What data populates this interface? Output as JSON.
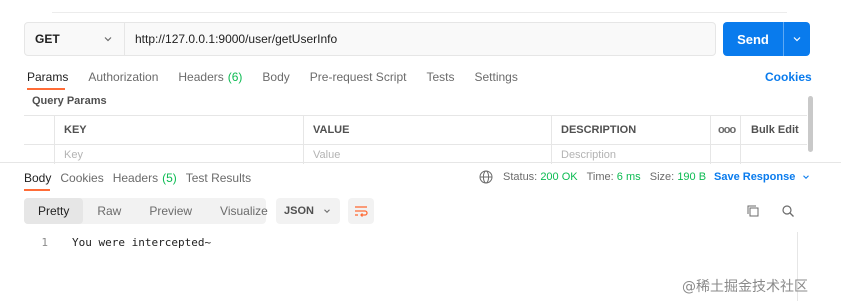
{
  "request": {
    "method": "GET",
    "url": "http://127.0.0.1:9000/user/getUserInfo",
    "send_label": "Send"
  },
  "request_tabs": {
    "params": "Params",
    "authorization": "Authorization",
    "headers": "Headers",
    "headers_count": "(6)",
    "body": "Body",
    "pre_request": "Pre-request Script",
    "tests": "Tests",
    "settings": "Settings",
    "cookies": "Cookies"
  },
  "query_params": {
    "title": "Query Params",
    "columns": {
      "key": "KEY",
      "value": "VALUE",
      "description": "DESCRIPTION",
      "more": "ooo",
      "bulk_edit": "Bulk Edit"
    },
    "placeholders": {
      "key": "Key",
      "value": "Value",
      "description": "Description"
    }
  },
  "response_tabs": {
    "body": "Body",
    "cookies": "Cookies",
    "headers": "Headers",
    "headers_count": "(5)",
    "test_results": "Test Results"
  },
  "response_meta": {
    "status_label": "Status:",
    "status_value": "200 OK",
    "time_label": "Time:",
    "time_value": "6 ms",
    "size_label": "Size:",
    "size_value": "190 B",
    "save_response": "Save Response"
  },
  "view_modes": [
    "Pretty",
    "Raw",
    "Preview",
    "Visualize"
  ],
  "format": "JSON",
  "response_body": {
    "line_number": "1",
    "text": "You were intercepted~"
  },
  "watermark": "@稀土掘金技术社区",
  "colors": {
    "accent": "#097bed",
    "tab_underline": "#ff6c37",
    "count_green": "#0cbb52"
  }
}
